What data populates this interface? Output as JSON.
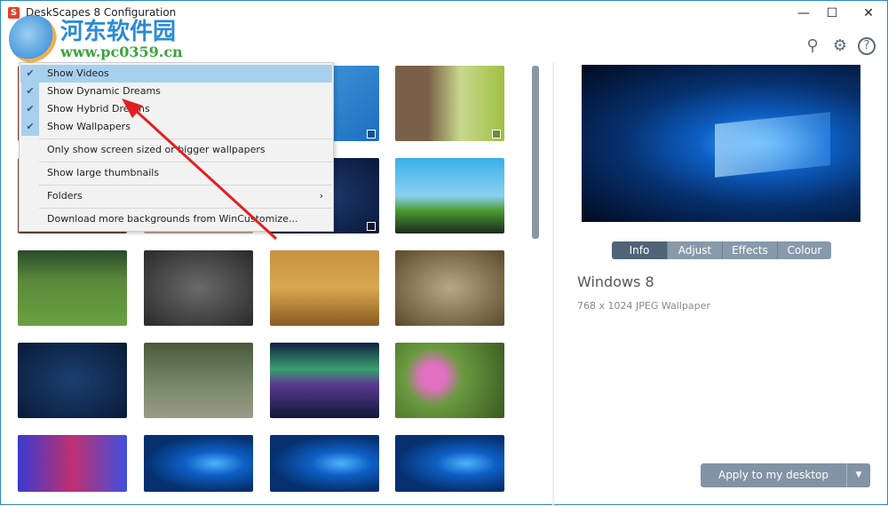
{
  "window": {
    "title": "DeskScapes 8 Configuration",
    "app_icon": "S",
    "minimize": "—",
    "maximize": "☐",
    "close": "✕"
  },
  "watermark": {
    "brand": "河东软件园",
    "url": "www.pc0359.cn"
  },
  "toolbar": {
    "search": "⚲",
    "settings": "⚙",
    "help": "?"
  },
  "menu": {
    "items": [
      {
        "label": "Show Videos",
        "checked": true
      },
      {
        "label": "Show Dynamic Dreams",
        "checked": true
      },
      {
        "label": "Show Hybrid Dreams",
        "checked": true
      },
      {
        "label": "Show Wallpapers",
        "checked": true
      },
      {
        "label": "Only show screen sized or bigger wallpapers"
      },
      {
        "label": "Show large thumbnails"
      },
      {
        "label": "Folders",
        "submenu": "›"
      },
      {
        "label": "Download more backgrounds from WinCustomize..."
      }
    ],
    "check_glyph": "✔"
  },
  "tabs": [
    "Info",
    "Adjust",
    "Effects",
    "Colour"
  ],
  "info": {
    "title": "Windows 8",
    "details": "768 x 1024 JPEG Wallpaper"
  },
  "apply": {
    "label": "Apply to my desktop",
    "dropdown": "▼"
  }
}
